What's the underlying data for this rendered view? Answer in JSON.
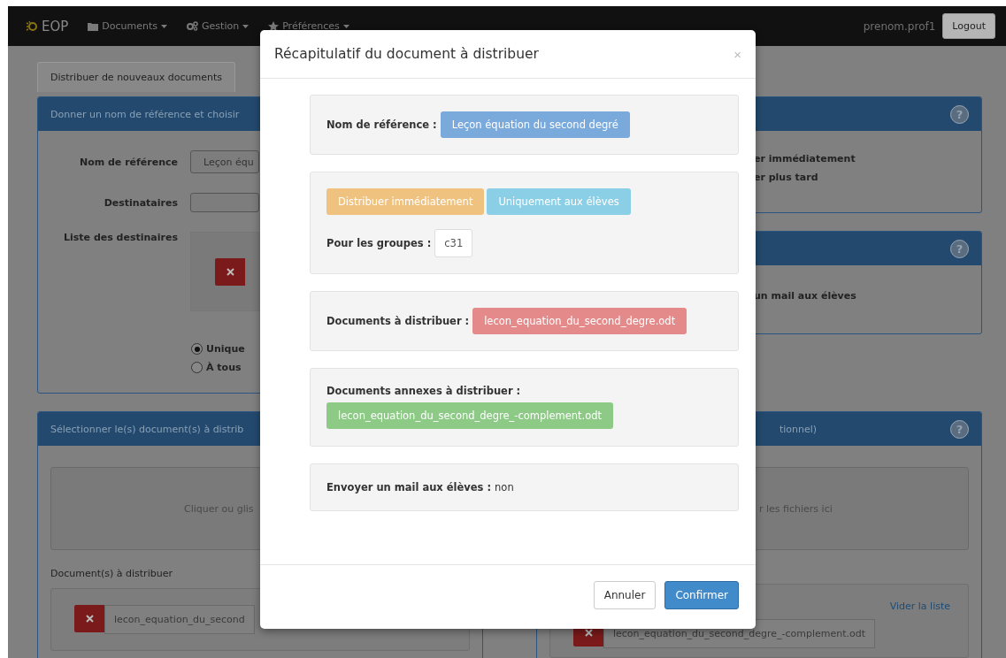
{
  "navbar": {
    "brand": "EOP",
    "menus": [
      {
        "kind": "folder",
        "label": "Documents"
      },
      {
        "kind": "gears",
        "label": "Gestion"
      },
      {
        "kind": "star",
        "label": "Préférences"
      }
    ],
    "user": "prenom.prof1",
    "logout": "Logout"
  },
  "tabs": [
    {
      "label": "Distribuer de nouveaux documents",
      "selected": true
    }
  ],
  "name_panel": {
    "header": "Donner un nom de référence et choisir",
    "name_label": "Nom de référence",
    "name_value": "Leçon équ",
    "recipients_label": "Destinataires",
    "list_label": "Liste des destinaires",
    "audience": [
      {
        "label": "Unique",
        "selected": true
      },
      {
        "label": "À tous",
        "selected": false
      }
    ]
  },
  "timing_panel": {
    "help": "?",
    "options": [
      "er immédiatement",
      "er plus tard"
    ]
  },
  "mail_panel": {
    "help": "?",
    "option": "un mail aux élèves"
  },
  "docs_panel": {
    "header": "Sélectionner le(s) document(s) à distrib",
    "dropzone": "Cliquer ou glis",
    "list_label": "Document(s) à distribuer",
    "files": [
      "lecon_equation_du_second"
    ]
  },
  "annex_panel": {
    "help": "?",
    "header": "tionnel)",
    "dropzone": "r les fichiers ici",
    "clear_link": "Vider la liste",
    "files": [
      "lecon_equation_du_second_degre_-complement.odt"
    ]
  },
  "modal": {
    "title": "Récapitulatif du document à distribuer",
    "close": "×",
    "sections": [
      {
        "kind": "inline",
        "label": "Nom de référence :",
        "tags": [
          {
            "text": "Leçon équation du second degré",
            "color": "#7aa9dc"
          }
        ]
      },
      {
        "kind": "options",
        "tags": [
          {
            "text": "Distribuer immédiatement",
            "color": "#f0c27f"
          },
          {
            "text": "Uniquement aux élèves",
            "color": "#8bcfe6"
          }
        ],
        "groups_label": "Pour les groupes :",
        "groups": [
          "c31"
        ]
      },
      {
        "kind": "inline",
        "label": "Documents à distribuer :",
        "tags": [
          {
            "text": "lecon_equation_du_second_degre.odt",
            "color": "#e58a8a"
          }
        ]
      },
      {
        "kind": "stacked",
        "label": "Documents annexes à distribuer :",
        "tags": [
          {
            "text": "lecon_equation_du_second_degre_-complement.odt",
            "color": "#8cca86"
          }
        ]
      },
      {
        "kind": "text",
        "label": "Envoyer un mail aux élèves :",
        "value": "non"
      }
    ],
    "buttons": [
      {
        "kind": "default",
        "label": "Annuler"
      },
      {
        "kind": "primary",
        "label": "Confirmer"
      }
    ]
  }
}
